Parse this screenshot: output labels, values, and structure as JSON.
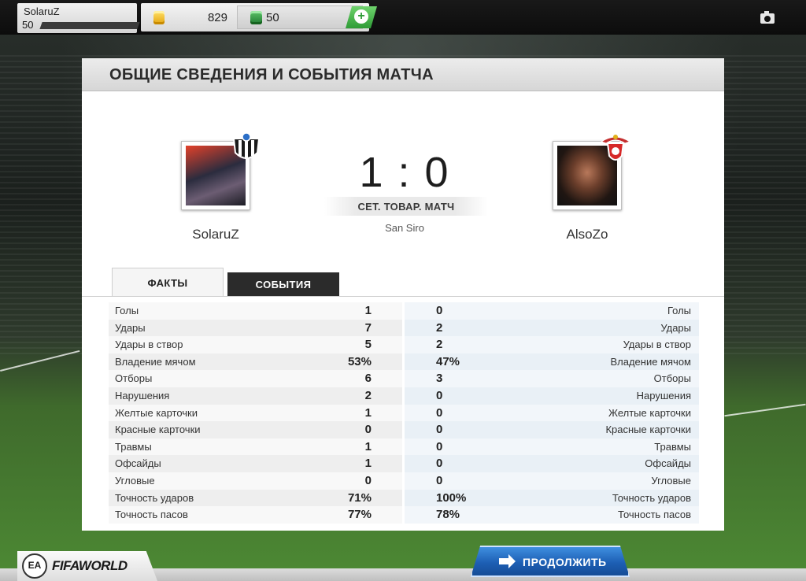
{
  "user": {
    "name": "SolaruZ",
    "level": "50"
  },
  "currency": {
    "coins": "829",
    "points": "50"
  },
  "panel": {
    "title": "ОБЩИЕ СВЕДЕНИЯ И СОБЫТИЯ МАТЧА"
  },
  "match": {
    "home_name": "SolaruZ",
    "away_name": "AlsoZo",
    "score": "1 : 0",
    "type": "СЕТ. ТОВАР. МАТЧ",
    "venue": "San Siro"
  },
  "tabs": {
    "facts": "ФАКТЫ",
    "events": "СОБЫТИЯ"
  },
  "stats": [
    {
      "label": "Голы",
      "home": "1",
      "away": "0"
    },
    {
      "label": "Удары",
      "home": "7",
      "away": "2"
    },
    {
      "label": "Удары в створ",
      "home": "5",
      "away": "2"
    },
    {
      "label": "Владение мячом",
      "home": "53%",
      "away": "47%"
    },
    {
      "label": "Отборы",
      "home": "6",
      "away": "3"
    },
    {
      "label": "Нарушения",
      "home": "2",
      "away": "0"
    },
    {
      "label": "Желтые карточки",
      "home": "1",
      "away": "0"
    },
    {
      "label": "Красные карточки",
      "home": "0",
      "away": "0"
    },
    {
      "label": "Травмы",
      "home": "1",
      "away": "0"
    },
    {
      "label": "Офсайды",
      "home": "1",
      "away": "0"
    },
    {
      "label": "Угловые",
      "home": "0",
      "away": "0"
    },
    {
      "label": "Точность ударов",
      "home": "71%",
      "away": "100%"
    },
    {
      "label": "Точность пасов",
      "home": "77%",
      "away": "78%"
    }
  ],
  "footer": {
    "continue_label": "ПРОДОЛЖИТЬ",
    "ea_logo": "EA",
    "game_logo": "FIFAWORLD"
  },
  "icons": {
    "coin": "coin-icon",
    "points": "fifa-points-icon",
    "add": "plus-icon",
    "camera": "camera-icon",
    "continue": "arrow-right-icon"
  },
  "colors": {
    "accent_green": "#2e9b36",
    "continue_blue": "#1d5fb4",
    "tab_dark": "#2b2b2b"
  }
}
